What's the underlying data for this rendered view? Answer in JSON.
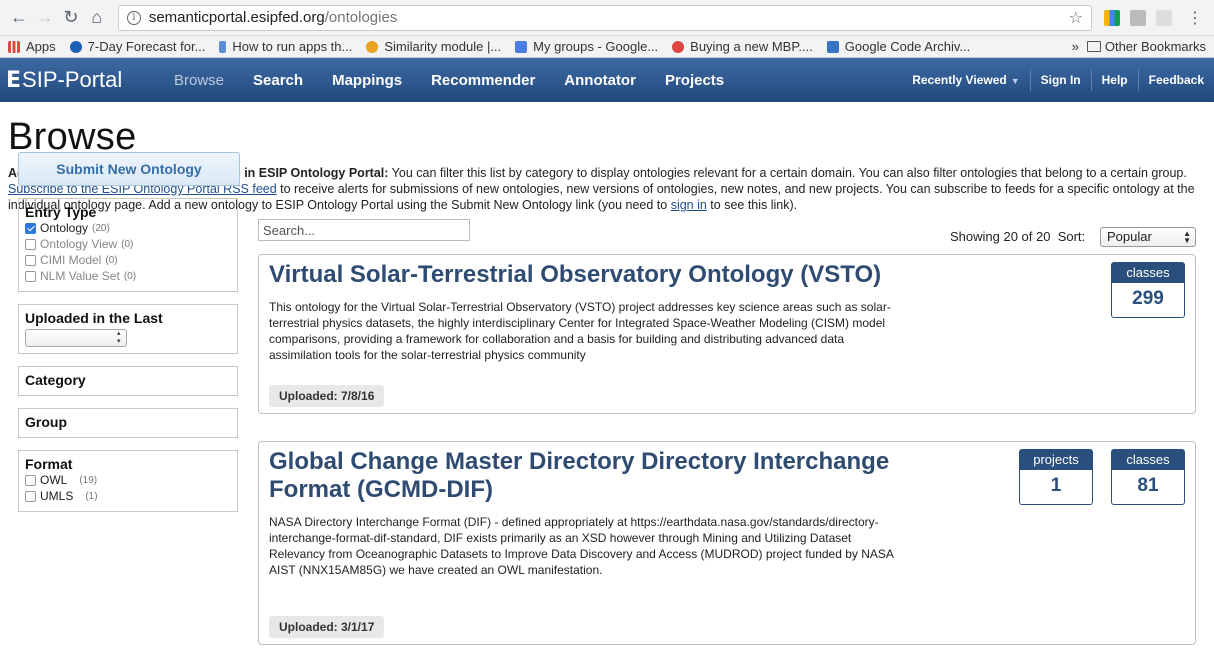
{
  "browser": {
    "url_host": "semanticportal.esipfed.org",
    "url_path": "/ontologies",
    "bookmarks": [
      {
        "label": "Apps",
        "color": "#e0493c"
      },
      {
        "label": "7-Day Forecast for...",
        "color": "#1a5fb4"
      },
      {
        "label": "How to run apps th...",
        "color": "#5a8fd6"
      },
      {
        "label": "Similarity module |...",
        "color": "#e7a321"
      },
      {
        "label": "My groups - Google...",
        "color": "#4a7de0"
      },
      {
        "label": "Buying a new MBP....",
        "color": "#d44"
      },
      {
        "label": "Google Code Archiv...",
        "color": "#3b73c4"
      }
    ],
    "overflow": "»",
    "other_bookmarks": "Other Bookmarks"
  },
  "nav": {
    "logo": "SIP-Portal",
    "logo_e": "E",
    "items": [
      "Browse",
      "Search",
      "Mappings",
      "Recommender",
      "Annotator",
      "Projects"
    ],
    "recently_viewed": "Recently Viewed",
    "sign_in": "Sign In",
    "help": "Help",
    "feedback": "Feedback"
  },
  "page": {
    "title": "Browse",
    "intro_bold": "Access all ontologies that are available in ESIP Ontology Portal:",
    "intro_1": " You can filter this list by category to display ontologies relevant for a certain domain. You can also filter ontologies that belong to a certain group. ",
    "intro_link": "Subscribe to the ESIP Ontology Portal RSS feed",
    "intro_2": " to receive alerts for submissions of new ontologies, new versions of ontologies, new notes, and new projects. You can subscribe to feeds for a specific ontology at the individual ontology page. Add a new ontology to ESIP Ontology Portal using the Submit New Ontology link (you need to ",
    "intro_signin": "sign in",
    "intro_3": " to see this link)."
  },
  "sidebar": {
    "submit": "Submit New Ontology",
    "entry_type_title": "Entry Type",
    "entry_types": [
      {
        "label": "Ontology",
        "count": "(20)",
        "checked": true
      },
      {
        "label": "Ontology View",
        "count": "(0)",
        "checked": false
      },
      {
        "label": "CIMI Model",
        "count": "(0)",
        "checked": false
      },
      {
        "label": "NLM Value Set",
        "count": "(0)",
        "checked": false
      }
    ],
    "uploaded_title": "Uploaded in the Last",
    "category_title": "Category",
    "group_title": "Group",
    "format_title": "Format",
    "formats": [
      {
        "label": "OWL",
        "count": "(19)"
      },
      {
        "label": "UMLS",
        "count": "(1)"
      }
    ]
  },
  "list": {
    "search_placeholder": "Search...",
    "showing": "Showing 20 of 20",
    "sort_label": "Sort:",
    "sort_value": "Popular"
  },
  "cards": [
    {
      "title": "Virtual Solar-Terrestrial Observatory Ontology (VSTO)",
      "description": "This ontology for the Virtual Solar-Terrestrial Observatory (VSTO) project addresses key science areas such as solar-terrestrial physics datasets, the highly interdisciplinary Center for Integrated Space-Weather Modeling (CISM) model comparisons, providing a framework for collaboration and a basis for building and distributing advanced data assimilation tools for the solar-terrestrial physics community",
      "uploaded": "Uploaded: 7/8/16",
      "classes_label": "classes",
      "classes": "299"
    },
    {
      "title": "Global Change Master Directory Directory Interchange Format (GCMD-DIF)",
      "description": "NASA Directory Interchange Format (DIF) - defined appropriately at https://earthdata.nasa.gov/standards/directory-interchange-format-dif-standard, DIF exists primarily as an XSD however through Mining and Utilizing Dataset Relevancy from Oceanographic Datasets to Improve Data Discovery and Access (MUDROD) project funded by NASA AIST (NNX15AM85G) we have created an OWL manifestation.",
      "uploaded": "Uploaded: 3/1/17",
      "projects_label": "projects",
      "projects": "1",
      "classes_label": "classes",
      "classes": "81"
    }
  ]
}
